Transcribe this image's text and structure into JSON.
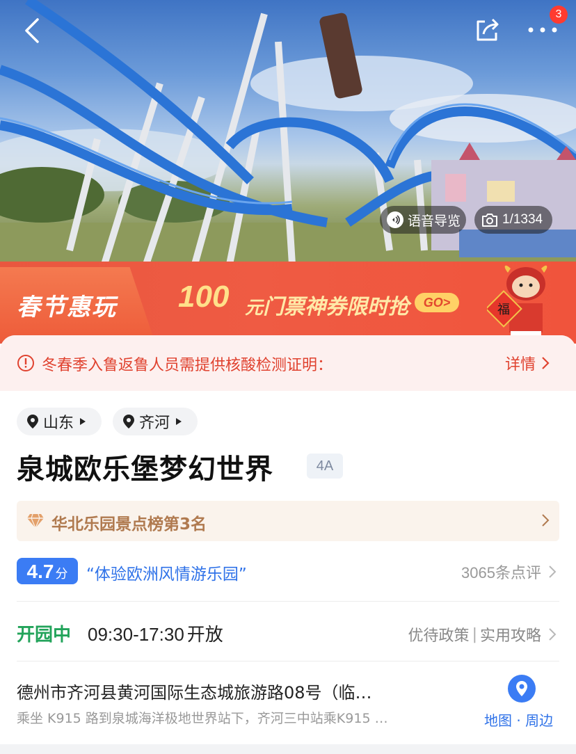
{
  "hero": {
    "audio_guide_label": "语音导览",
    "photo_counter": "1/1334",
    "notification_count": "3",
    "icons": [
      "back-icon",
      "share-icon",
      "more-icon",
      "audio-icon",
      "camera-icon"
    ]
  },
  "promo": {
    "title": "春节惠玩",
    "amount": "100",
    "unit": "元",
    "text": "门票神券限时抢",
    "go_label": "GO>"
  },
  "notice": {
    "text": "冬春季入鲁返鲁人员需提供核酸检测证明：",
    "link_label": "详情"
  },
  "location_tags": [
    {
      "label": "山东"
    },
    {
      "label": "齐河"
    }
  ],
  "attraction": {
    "name": "泉城欧乐堡梦幻世界",
    "level": "4A"
  },
  "ranking": {
    "text": "华北乐园景点榜第3名"
  },
  "rating": {
    "score": "4.7",
    "unit": "分",
    "quote": "“体验欧洲风情游乐园”",
    "review_count": "3065条点评"
  },
  "hours": {
    "status": "开园中",
    "time": "09:30-17:30",
    "open_label": "开放",
    "policy_label": "优待政策",
    "separator": "|",
    "guide_label": "实用攻略"
  },
  "address": {
    "text": "德州市齐河县黄河国际生态城旅游路08号（临…",
    "transit": "乘坐 K915 路到泉城海洋极地世界站下，齐河三中站乘K915 …",
    "map_label": "地图 · 周边"
  },
  "colors": {
    "accent_red": "#e0422f",
    "promo_bg": "#ef5b43",
    "rating_blue": "#3b7cf4",
    "open_green": "#22a35a",
    "rank_gold": "#b07a4f"
  }
}
